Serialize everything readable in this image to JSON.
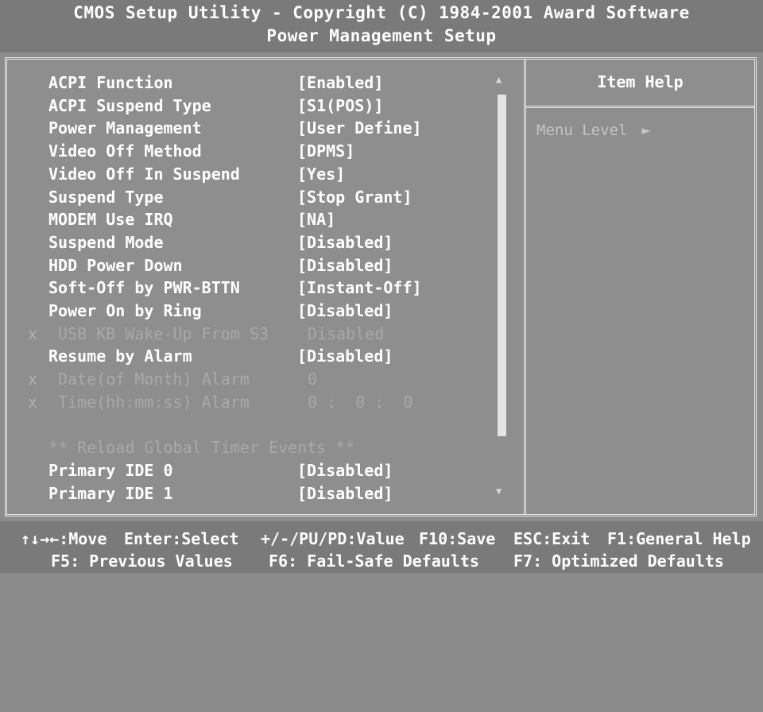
{
  "header": {
    "line1": "CMOS Setup Utility - Copyright (C) 1984-2001 Award Software",
    "line2": "Power Management Setup"
  },
  "items": [
    {
      "label": "ACPI Function",
      "value": "[Enabled]",
      "disabled": false
    },
    {
      "label": "ACPI Suspend Type",
      "value": "[S1(POS)]",
      "disabled": false
    },
    {
      "label": "Power Management",
      "value": "[User Define]",
      "disabled": false
    },
    {
      "label": "Video Off Method",
      "value": "[DPMS]",
      "disabled": false
    },
    {
      "label": "Video Off In Suspend",
      "value": "[Yes]",
      "disabled": false
    },
    {
      "label": "Suspend Type",
      "value": "[Stop Grant]",
      "disabled": false
    },
    {
      "label": "MODEM Use IRQ",
      "value": "[NA]",
      "disabled": false
    },
    {
      "label": "Suspend Mode",
      "value": "[Disabled]",
      "disabled": false
    },
    {
      "label": "HDD Power Down",
      "value": "[Disabled]",
      "disabled": false
    },
    {
      "label": "Soft-Off by PWR-BTTN",
      "value": "[Instant-Off]",
      "disabled": false
    },
    {
      "label": "Power On by Ring",
      "value": "[Disabled]",
      "disabled": false
    },
    {
      "label": "USB KB Wake-Up From S3",
      "value": "Disabled",
      "disabled": true
    },
    {
      "label": "Resume by Alarm",
      "value": "[Disabled]",
      "disabled": false
    },
    {
      "label": "Date(of Month) Alarm",
      "value": "0",
      "disabled": true
    },
    {
      "label": "Time(hh:mm:ss) Alarm",
      "value": "0 :  0 :  0",
      "disabled": true
    },
    {
      "label": "",
      "value": "",
      "disabled": false
    },
    {
      "label": "** Reload Global Timer Events **",
      "value": "",
      "section": true
    },
    {
      "label": "Primary IDE 0",
      "value": "[Disabled]",
      "disabled": false
    },
    {
      "label": "Primary IDE 1",
      "value": "[Disabled]",
      "disabled": false
    }
  ],
  "disabled_marker": "x",
  "help": {
    "title": "Item Help",
    "menu_level_label": "Menu Level",
    "menu_level_arrow": "►"
  },
  "scroll": {
    "up": "▲",
    "down": "▼"
  },
  "footer": {
    "move": "↑↓→←:Move",
    "enter": "Enter:Select",
    "value": "+/-/PU/PD:Value",
    "save": "F10:Save",
    "exit": "ESC:Exit",
    "help": "F1:General Help",
    "f5": "F5: Previous Values",
    "f6": "F6: Fail-Safe Defaults",
    "f7": "F7: Optimized Defaults"
  }
}
